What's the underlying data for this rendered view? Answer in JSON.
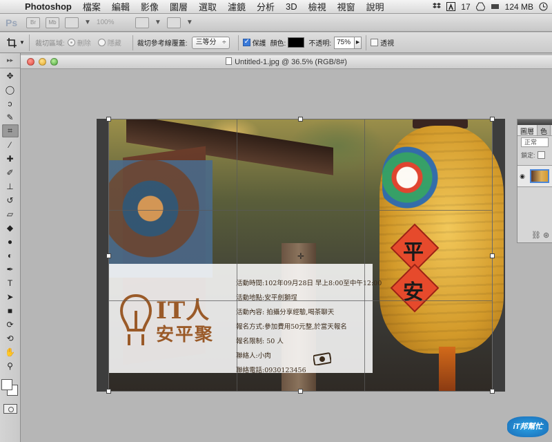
{
  "menubar": {
    "app_name": "Photoshop",
    "menus": [
      "檔案",
      "編輯",
      "影像",
      "圖層",
      "選取",
      "濾鏡",
      "分析",
      "3D",
      "檢視",
      "視窗",
      "說明"
    ],
    "status_adobe_count": "17",
    "memory": "124 MB"
  },
  "appbar": {
    "logo": "Ps",
    "br_label": "Br",
    "mb_label": "Mb",
    "zoom": "100%"
  },
  "options": {
    "crop_area_label": "裁切區域:",
    "delete_label": "刪除",
    "hide_label": "隱藏",
    "overlay_label": "裁切參考線覆蓋:",
    "overlay_value": "三等分",
    "shield_label": "保護",
    "color_label": "顏色:",
    "opacity_label": "不透明:",
    "opacity_value": "75%",
    "perspective_label": "透視",
    "shield_color": "#000000"
  },
  "document": {
    "title": "Untitled-1.jpg @ 36.5% (RGB/8#)"
  },
  "poster": {
    "logo_line1": "IT人",
    "logo_line2": "安平聚",
    "lantern_char1": "平",
    "lantern_char2": "安",
    "details": [
      "活動時間:102年09月28日 早上8:00至中午12:00",
      "活動地點:安平劍獅埕",
      "活動內容: 拍攝分享經驗,喝茶聊天",
      "報名方式:參加費用50元整,於當天報名",
      "報名限制: 50 人",
      "聯絡人:小肉",
      "聯絡電話:0930123456"
    ]
  },
  "layers_panel": {
    "tab_layers": "圖層",
    "tab_color": "色",
    "blend_mode": "正常",
    "lock_label": "鎖定:"
  },
  "watermark": {
    "text": "iT邦幫忙"
  }
}
